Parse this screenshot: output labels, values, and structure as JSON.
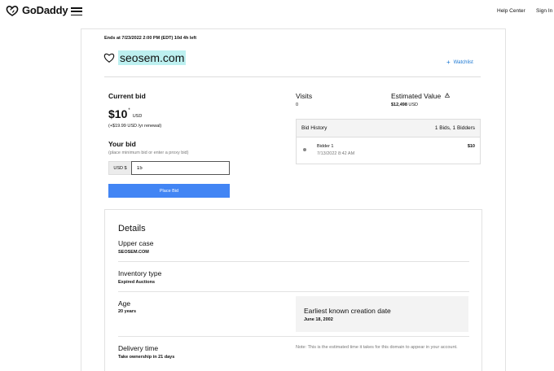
{
  "header": {
    "logo_text": "GoDaddy",
    "help_center": "Help Center",
    "sign_in": "Sign In"
  },
  "auction": {
    "ends": "Ends at 7/23/2022 2:00 PM (EDT) 10d 4h left",
    "domain": "seosem.com",
    "watchlist_label": "Watchlist"
  },
  "current_bid": {
    "label": "Current bid",
    "amount": "$10",
    "asterisk": "*",
    "currency": "USD",
    "renewal": "(+$19.99 USD /yr renewal)"
  },
  "your_bid": {
    "label": "Your bid",
    "hint": "(place minimum bid or enter a proxy bid)",
    "prefix": "USD $",
    "value": "15",
    "button": "Place Bid"
  },
  "visits": {
    "label": "Visits",
    "value": "0"
  },
  "estimated": {
    "label": "Estimated Value",
    "value": "$12,498",
    "currency": "USD"
  },
  "bid_history": {
    "title": "Bid History",
    "counts": "1 Bids, 1 Bidders",
    "rows": [
      {
        "bidder": "Bidder 1",
        "time": "7/13/2022 8:42 AM",
        "amount": "$10"
      }
    ]
  },
  "details": {
    "title": "Details",
    "items": [
      {
        "label": "Upper case",
        "value": "SEOSEM.COM"
      },
      {
        "label": "Inventory type",
        "value": "Expired Auctions"
      },
      {
        "label": "Age",
        "value": "20 years"
      },
      {
        "label": "Delivery time",
        "value": "Take ownership in 21 days"
      }
    ],
    "earliest_label": "Earliest known creation date",
    "earliest_value": "June 18, 2002",
    "note": "Note: This is the estimated time it takes for this domain to appear in your account."
  },
  "colors": {
    "accent_blue": "#4285f4",
    "link_blue": "#1976d2",
    "domain_highlight": "#bdf0f0"
  }
}
